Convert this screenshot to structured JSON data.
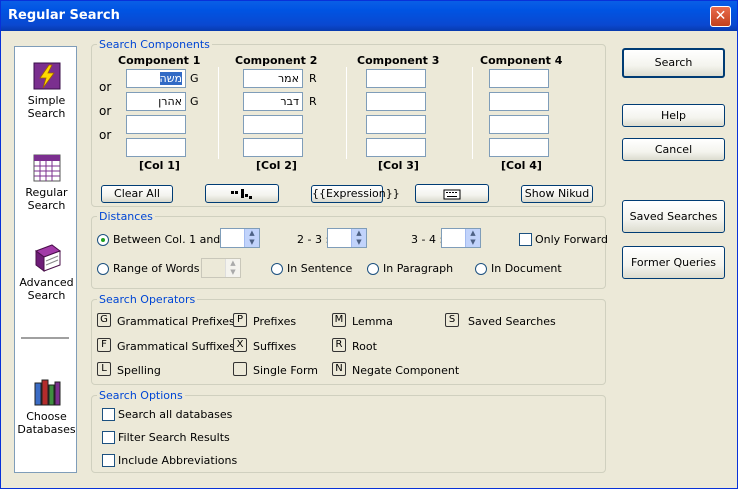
{
  "window": {
    "title": "Regular Search",
    "close": "✕"
  },
  "nav": {
    "simple": {
      "line1": "Simple",
      "line2": "Search"
    },
    "regular": {
      "line1": "Regular",
      "line2": "Search"
    },
    "advanced": {
      "line1": "Advanced",
      "line2": "Search"
    },
    "choose": {
      "line1": "Choose",
      "line2": "Databases"
    }
  },
  "components": {
    "legend": "Search Components",
    "headers": [
      "Component 1",
      "Component 2",
      "Component 3",
      "Component 4"
    ],
    "row_labels": [
      "or",
      "or",
      "or"
    ],
    "col_labels": [
      "[Col 1]",
      "[Col 2]",
      "[Col 3]",
      "[Col 4]"
    ],
    "col1": [
      {
        "value": "משה",
        "tag": "G"
      },
      {
        "value": "אהרן",
        "tag": "G"
      },
      {
        "value": "",
        "tag": ""
      },
      {
        "value": "",
        "tag": ""
      }
    ],
    "col2": [
      {
        "value": "אמר",
        "tag": "R"
      },
      {
        "value": "דבר",
        "tag": "R"
      },
      {
        "value": "",
        "tag": ""
      },
      {
        "value": "",
        "tag": ""
      }
    ],
    "buttons": {
      "clear_all": "Clear All",
      "expression": "{{Expression}}",
      "show_nikud": "Show Nikud"
    }
  },
  "distances": {
    "legend": "Distances",
    "between": "Between Col. 1 and 2",
    "d23": "2 - 3 :",
    "d34": "3 - 4 :",
    "only_forward": "Only Forward",
    "range": "Range of Words",
    "in_sentence": "In Sentence",
    "in_paragraph": "In Paragraph",
    "in_document": "In Document"
  },
  "operators": {
    "legend": "Search Operators",
    "items": [
      {
        "key": "G",
        "label": "Grammatical Prefixes"
      },
      {
        "key": "P",
        "label": "Prefixes"
      },
      {
        "key": "M",
        "label": "Lemma"
      },
      {
        "key": "S",
        "label": "Saved Searches"
      },
      {
        "key": "F",
        "label": "Grammatical Suffixes"
      },
      {
        "key": "X",
        "label": "Suffixes"
      },
      {
        "key": "R",
        "label": "Root"
      },
      {
        "key": "L",
        "label": "Spelling"
      },
      {
        "key": "",
        "label": "Single Form"
      },
      {
        "key": "N",
        "label": "Negate Component"
      }
    ]
  },
  "options": {
    "legend": "Search Options",
    "search_all": "Search all databases",
    "filter": "Filter Search Results",
    "abbrev": "Include Abbreviations"
  },
  "side_buttons": {
    "search": "Search",
    "help": "Help",
    "cancel": "Cancel",
    "saved": "Saved Searches",
    "former": "Former Queries"
  }
}
